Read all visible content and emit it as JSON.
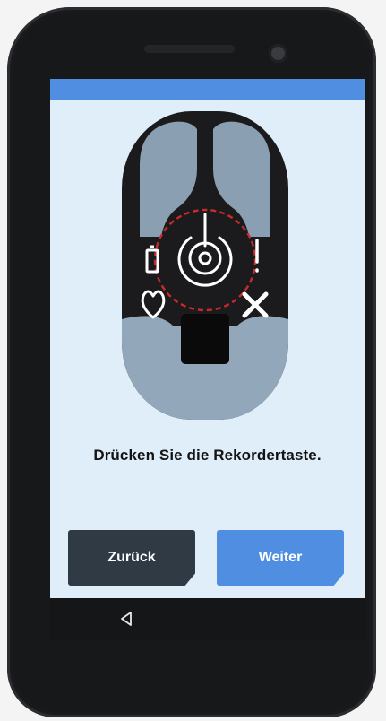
{
  "screen": {
    "instruction": "Drücken Sie die Rekordertaste."
  },
  "buttons": {
    "back_label": "Zurück",
    "next_label": "Weiter"
  },
  "icons": {
    "power": "power-icon",
    "battery": "battery-icon",
    "warning": "exclamation-icon",
    "heart": "heart-icon",
    "cancel": "x-icon",
    "nav_back": "back-triangle-icon"
  },
  "colors": {
    "accent": "#4f8ee0",
    "back_button": "#2f3a45",
    "screen_background": "#dfeef8",
    "highlight_ring": "#cc2a2a"
  }
}
